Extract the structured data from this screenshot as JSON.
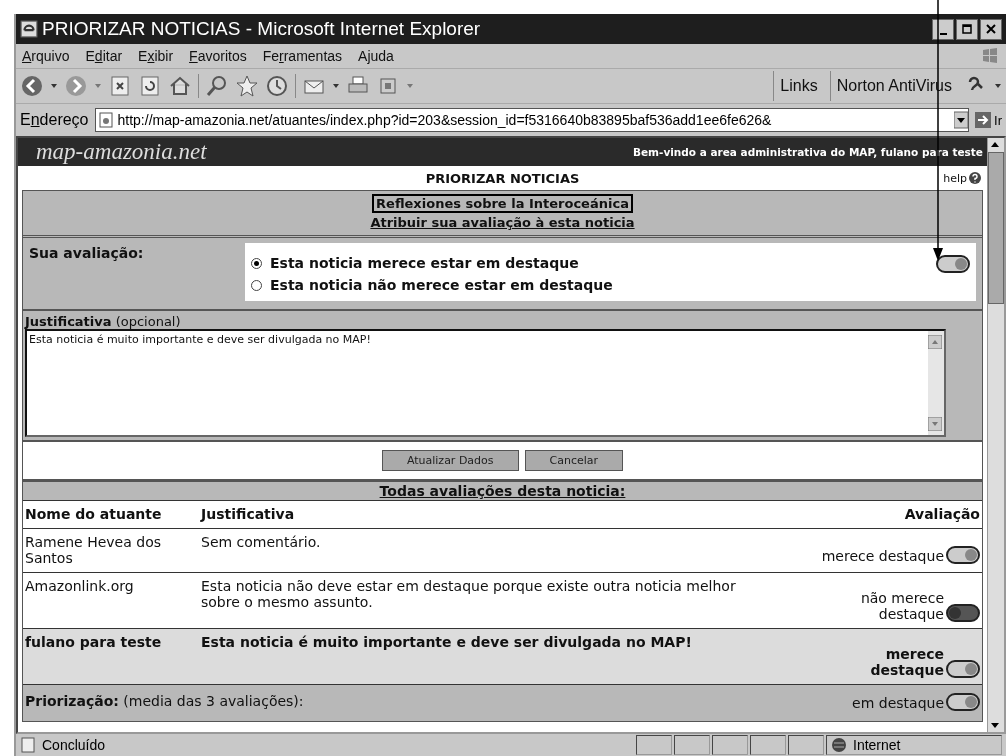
{
  "window": {
    "title": "PRIORIZAR NOTICIAS - Microsoft Internet Explorer"
  },
  "menu": [
    {
      "key": "A",
      "after": "rquivo"
    },
    {
      "before": "E",
      "key": "d",
      "after": "itar"
    },
    {
      "before": "E",
      "key": "x",
      "after": "ibir"
    },
    {
      "key": "F",
      "after": "avoritos"
    },
    {
      "before": "Fe",
      "key": "r",
      "after": "ramentas"
    },
    {
      "before": "A",
      "key": "j",
      "after": "uda"
    }
  ],
  "toolbar": {
    "links": "Links",
    "norton": "Norton AntiVirus"
  },
  "address": {
    "before": "E",
    "key": "n",
    "after": "dereço",
    "url": "http://map-amazonia.net/atuantes/index.php?id=203&session_id=f5316640b83895baf536add1ee6fe626&",
    "go": "Ir"
  },
  "banner": {
    "logo": "map-amazonia.net",
    "welcome": "Bem-vindo a area administrativa do MAP, fulano para teste"
  },
  "page_title": "PRIORIZAR NOTICIAS",
  "help": "help",
  "news_title": "Reflexiones sobre la Interoceánica",
  "subtitle": "Atribuir sua avaliação à esta noticia",
  "rating": {
    "label": "Sua avaliação:",
    "toggle_on": true,
    "options": [
      {
        "label": "Esta noticia merece estar em destaque",
        "selected": true
      },
      {
        "label": "Esta noticia não merece estar em destaque",
        "selected": false
      }
    ]
  },
  "justification": {
    "label": "Justificativa",
    "hint": "(opcional)",
    "value": "Esta noticia é muito importante e deve ser divulgada no MAP!"
  },
  "buttons": [
    "Atualizar Dados",
    "Cancelar"
  ],
  "all_ratings": {
    "title": "Todas avaliações desta noticia:",
    "columns": [
      "Nome do atuante",
      "Justificativa",
      "Avaliação"
    ],
    "rows": [
      {
        "name": "Ramene Hevea dos Santos",
        "justification": "Sem comentário.",
        "rating": "merece destaque",
        "toggle_on": true,
        "own": false
      },
      {
        "name": "Amazonlink.org",
        "justification": "Esta noticia não deve estar em destaque porque existe outra noticia melhor sobre o mesmo assunto.",
        "rating": "não merece destaque",
        "toggle_on": false,
        "own": false
      },
      {
        "name": "fulano para teste",
        "justification": "Esta noticia é muito importante e deve ser divulgada no MAP!",
        "rating": "merece destaque",
        "toggle_on": true,
        "own": true
      }
    ]
  },
  "summary": {
    "label": "Priorização:",
    "text": "(media das 3 avaliações):",
    "rating": "em destaque",
    "toggle_on": true
  },
  "status": {
    "text": "Concluído",
    "zone": "Internet"
  }
}
